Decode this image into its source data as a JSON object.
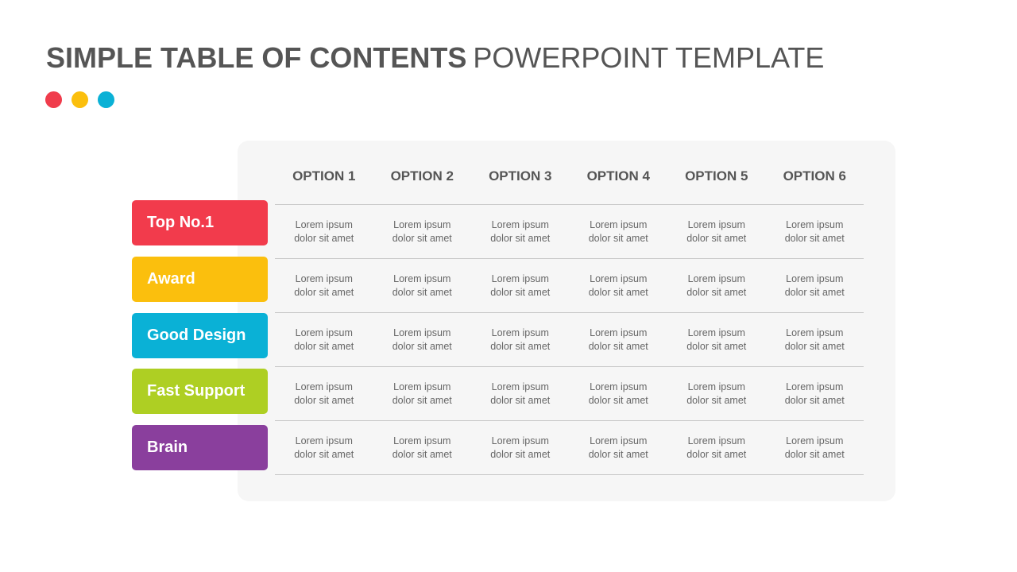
{
  "title": {
    "bold": "SIMPLE TABLE OF CONTENTS",
    "light": "POWERPOINT TEMPLATE"
  },
  "dots": [
    {
      "name": "red-dot",
      "color": "#f03c4c"
    },
    {
      "name": "yellow-dot",
      "color": "#fbbf0d"
    },
    {
      "name": "blue-dot",
      "color": "#0ab1d6"
    }
  ],
  "table": {
    "headers": [
      "OPTION 1",
      "OPTION 2",
      "OPTION 3",
      "OPTION 4",
      "OPTION 5",
      "OPTION 6"
    ],
    "rows": [
      {
        "label": "Top No.1",
        "color": "#f23b4c",
        "cells": [
          "Lorem ipsum\ndolor sit amet",
          "Lorem ipsum\ndolor sit amet",
          "Lorem ipsum\ndolor sit amet",
          "Lorem ipsum\ndolor sit amet",
          "Lorem ipsum\ndolor sit amet",
          "Lorem ipsum\ndolor sit amet"
        ]
      },
      {
        "label": "Award",
        "color": "#fbbf0d",
        "cells": [
          "Lorem ipsum\ndolor sit amet",
          "Lorem ipsum\ndolor sit amet",
          "Lorem ipsum\ndolor sit amet",
          "Lorem ipsum\ndolor sit amet",
          "Lorem ipsum\ndolor sit amet",
          "Lorem ipsum\ndolor sit amet"
        ]
      },
      {
        "label": "Good Design",
        "color": "#0ab1d6",
        "cells": [
          "Lorem ipsum\ndolor sit amet",
          "Lorem ipsum\ndolor sit amet",
          "Lorem ipsum\ndolor sit amet",
          "Lorem ipsum\ndolor sit amet",
          "Lorem ipsum\ndolor sit amet",
          "Lorem ipsum\ndolor sit amet"
        ]
      },
      {
        "label": "Fast Support",
        "color": "#aecf23",
        "cells": [
          "Lorem ipsum\ndolor sit amet",
          "Lorem ipsum\ndolor sit amet",
          "Lorem ipsum\ndolor sit amet",
          "Lorem ipsum\ndolor sit amet",
          "Lorem ipsum\ndolor sit amet",
          "Lorem ipsum\ndolor sit amet"
        ]
      },
      {
        "label": "Brain",
        "color": "#8a3f9d",
        "cells": [
          "Lorem ipsum\ndolor sit amet",
          "Lorem ipsum\ndolor sit amet",
          "Lorem ipsum\ndolor sit amet",
          "Lorem ipsum\ndolor sit amet",
          "Lorem ipsum\ndolor sit amet",
          "Lorem ipsum\ndolor sit amet"
        ]
      }
    ]
  }
}
